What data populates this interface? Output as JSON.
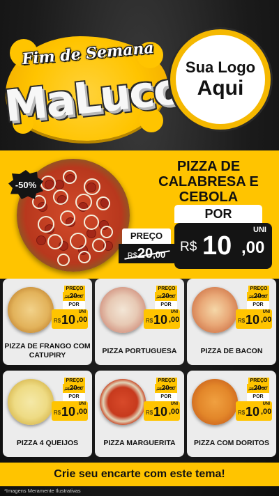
{
  "header": {
    "title_top": "Fim de Semana",
    "title_main": "MaLuco",
    "logo_line1": "Sua Logo",
    "logo_line2": "Aqui"
  },
  "featured": {
    "discount": "-50%",
    "name": "PIZZA DE CALABRESA E CEBOLA",
    "preco_label": "PREÇO",
    "old_currency": "R$",
    "old_int": "20",
    "old_cents": ",00",
    "por_label": "POR",
    "unit": "UNI",
    "currency": "R$",
    "price_int": "10",
    "price_cents": ",00"
  },
  "products": [
    {
      "name": "PIZZA DE FRANGO COM CATUPIRY",
      "preco_label": "PREÇO",
      "old_currency": "R$",
      "old_int": "20",
      "old_cents": "00",
      "por_label": "POR",
      "unit": "UNI",
      "currency": "R$",
      "price_int": "10",
      "price_cents": ",00"
    },
    {
      "name": "PIZZA PORTUGUESA",
      "preco_label": "PREÇO",
      "old_currency": "R$",
      "old_int": "20",
      "old_cents": "00",
      "por_label": "POR",
      "unit": "UNI",
      "currency": "R$",
      "price_int": "10",
      "price_cents": ",00"
    },
    {
      "name": "PIZZA DE BACON",
      "preco_label": "PREÇO",
      "old_currency": "R$",
      "old_int": "20",
      "old_cents": "00",
      "por_label": "POR",
      "unit": "UNI",
      "currency": "R$",
      "price_int": "10",
      "price_cents": ",00"
    },
    {
      "name": "PIZZA 4 QUEIJOS",
      "preco_label": "PREÇO",
      "old_currency": "R$",
      "old_int": "20",
      "old_cents": "00",
      "por_label": "POR",
      "unit": "UNI",
      "currency": "R$",
      "price_int": "10",
      "price_cents": ",00"
    },
    {
      "name": "PIZZA MARGUERITA",
      "preco_label": "PREÇO",
      "old_currency": "R$",
      "old_int": "20",
      "old_cents": "00",
      "por_label": "POR",
      "unit": "UNI",
      "currency": "R$",
      "price_int": "10",
      "price_cents": ",00"
    },
    {
      "name": "PIZZA COM DORITOS",
      "preco_label": "PREÇO",
      "old_currency": "R$",
      "old_int": "20",
      "old_cents": "00",
      "por_label": "POR",
      "unit": "UNI",
      "currency": "R$",
      "price_int": "10",
      "price_cents": ",00"
    }
  ],
  "footer": {
    "cta": "Crie seu encarte com este tema!",
    "disclaimer": "*Imagens Meramente Ilustrativas"
  },
  "colors": {
    "accent": "#ffc400",
    "dark": "#141414",
    "card": "#ececec"
  }
}
